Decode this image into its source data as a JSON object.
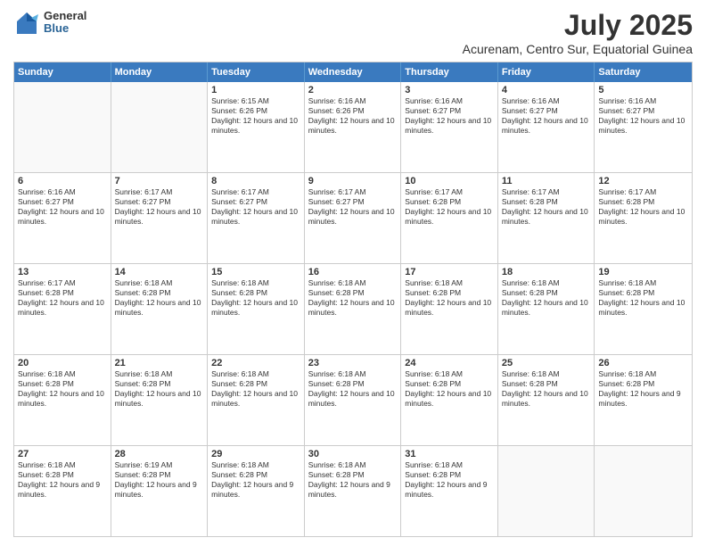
{
  "header": {
    "logo": {
      "line1": "General",
      "line2": "Blue"
    },
    "title": "July 2025",
    "subtitle": "Acurenam, Centro Sur, Equatorial Guinea"
  },
  "days": [
    "Sunday",
    "Monday",
    "Tuesday",
    "Wednesday",
    "Thursday",
    "Friday",
    "Saturday"
  ],
  "rows": [
    [
      {
        "day": "",
        "empty": true
      },
      {
        "day": "",
        "empty": true
      },
      {
        "day": "1",
        "sunrise": "6:15 AM",
        "sunset": "6:26 PM",
        "daylight": "12 hours and 10 minutes."
      },
      {
        "day": "2",
        "sunrise": "6:16 AM",
        "sunset": "6:26 PM",
        "daylight": "12 hours and 10 minutes."
      },
      {
        "day": "3",
        "sunrise": "6:16 AM",
        "sunset": "6:27 PM",
        "daylight": "12 hours and 10 minutes."
      },
      {
        "day": "4",
        "sunrise": "6:16 AM",
        "sunset": "6:27 PM",
        "daylight": "12 hours and 10 minutes."
      },
      {
        "day": "5",
        "sunrise": "6:16 AM",
        "sunset": "6:27 PM",
        "daylight": "12 hours and 10 minutes."
      }
    ],
    [
      {
        "day": "6",
        "sunrise": "6:16 AM",
        "sunset": "6:27 PM",
        "daylight": "12 hours and 10 minutes."
      },
      {
        "day": "7",
        "sunrise": "6:17 AM",
        "sunset": "6:27 PM",
        "daylight": "12 hours and 10 minutes."
      },
      {
        "day": "8",
        "sunrise": "6:17 AM",
        "sunset": "6:27 PM",
        "daylight": "12 hours and 10 minutes."
      },
      {
        "day": "9",
        "sunrise": "6:17 AM",
        "sunset": "6:27 PM",
        "daylight": "12 hours and 10 minutes."
      },
      {
        "day": "10",
        "sunrise": "6:17 AM",
        "sunset": "6:28 PM",
        "daylight": "12 hours and 10 minutes."
      },
      {
        "day": "11",
        "sunrise": "6:17 AM",
        "sunset": "6:28 PM",
        "daylight": "12 hours and 10 minutes."
      },
      {
        "day": "12",
        "sunrise": "6:17 AM",
        "sunset": "6:28 PM",
        "daylight": "12 hours and 10 minutes."
      }
    ],
    [
      {
        "day": "13",
        "sunrise": "6:17 AM",
        "sunset": "6:28 PM",
        "daylight": "12 hours and 10 minutes."
      },
      {
        "day": "14",
        "sunrise": "6:18 AM",
        "sunset": "6:28 PM",
        "daylight": "12 hours and 10 minutes."
      },
      {
        "day": "15",
        "sunrise": "6:18 AM",
        "sunset": "6:28 PM",
        "daylight": "12 hours and 10 minutes."
      },
      {
        "day": "16",
        "sunrise": "6:18 AM",
        "sunset": "6:28 PM",
        "daylight": "12 hours and 10 minutes."
      },
      {
        "day": "17",
        "sunrise": "6:18 AM",
        "sunset": "6:28 PM",
        "daylight": "12 hours and 10 minutes."
      },
      {
        "day": "18",
        "sunrise": "6:18 AM",
        "sunset": "6:28 PM",
        "daylight": "12 hours and 10 minutes."
      },
      {
        "day": "19",
        "sunrise": "6:18 AM",
        "sunset": "6:28 PM",
        "daylight": "12 hours and 10 minutes."
      }
    ],
    [
      {
        "day": "20",
        "sunrise": "6:18 AM",
        "sunset": "6:28 PM",
        "daylight": "12 hours and 10 minutes."
      },
      {
        "day": "21",
        "sunrise": "6:18 AM",
        "sunset": "6:28 PM",
        "daylight": "12 hours and 10 minutes."
      },
      {
        "day": "22",
        "sunrise": "6:18 AM",
        "sunset": "6:28 PM",
        "daylight": "12 hours and 10 minutes."
      },
      {
        "day": "23",
        "sunrise": "6:18 AM",
        "sunset": "6:28 PM",
        "daylight": "12 hours and 10 minutes."
      },
      {
        "day": "24",
        "sunrise": "6:18 AM",
        "sunset": "6:28 PM",
        "daylight": "12 hours and 10 minutes."
      },
      {
        "day": "25",
        "sunrise": "6:18 AM",
        "sunset": "6:28 PM",
        "daylight": "12 hours and 10 minutes."
      },
      {
        "day": "26",
        "sunrise": "6:18 AM",
        "sunset": "6:28 PM",
        "daylight": "12 hours and 9 minutes."
      }
    ],
    [
      {
        "day": "27",
        "sunrise": "6:18 AM",
        "sunset": "6:28 PM",
        "daylight": "12 hours and 9 minutes."
      },
      {
        "day": "28",
        "sunrise": "6:19 AM",
        "sunset": "6:28 PM",
        "daylight": "12 hours and 9 minutes."
      },
      {
        "day": "29",
        "sunrise": "6:18 AM",
        "sunset": "6:28 PM",
        "daylight": "12 hours and 9 minutes."
      },
      {
        "day": "30",
        "sunrise": "6:18 AM",
        "sunset": "6:28 PM",
        "daylight": "12 hours and 9 minutes."
      },
      {
        "day": "31",
        "sunrise": "6:18 AM",
        "sunset": "6:28 PM",
        "daylight": "12 hours and 9 minutes."
      },
      {
        "day": "",
        "empty": true
      },
      {
        "day": "",
        "empty": true
      }
    ]
  ]
}
